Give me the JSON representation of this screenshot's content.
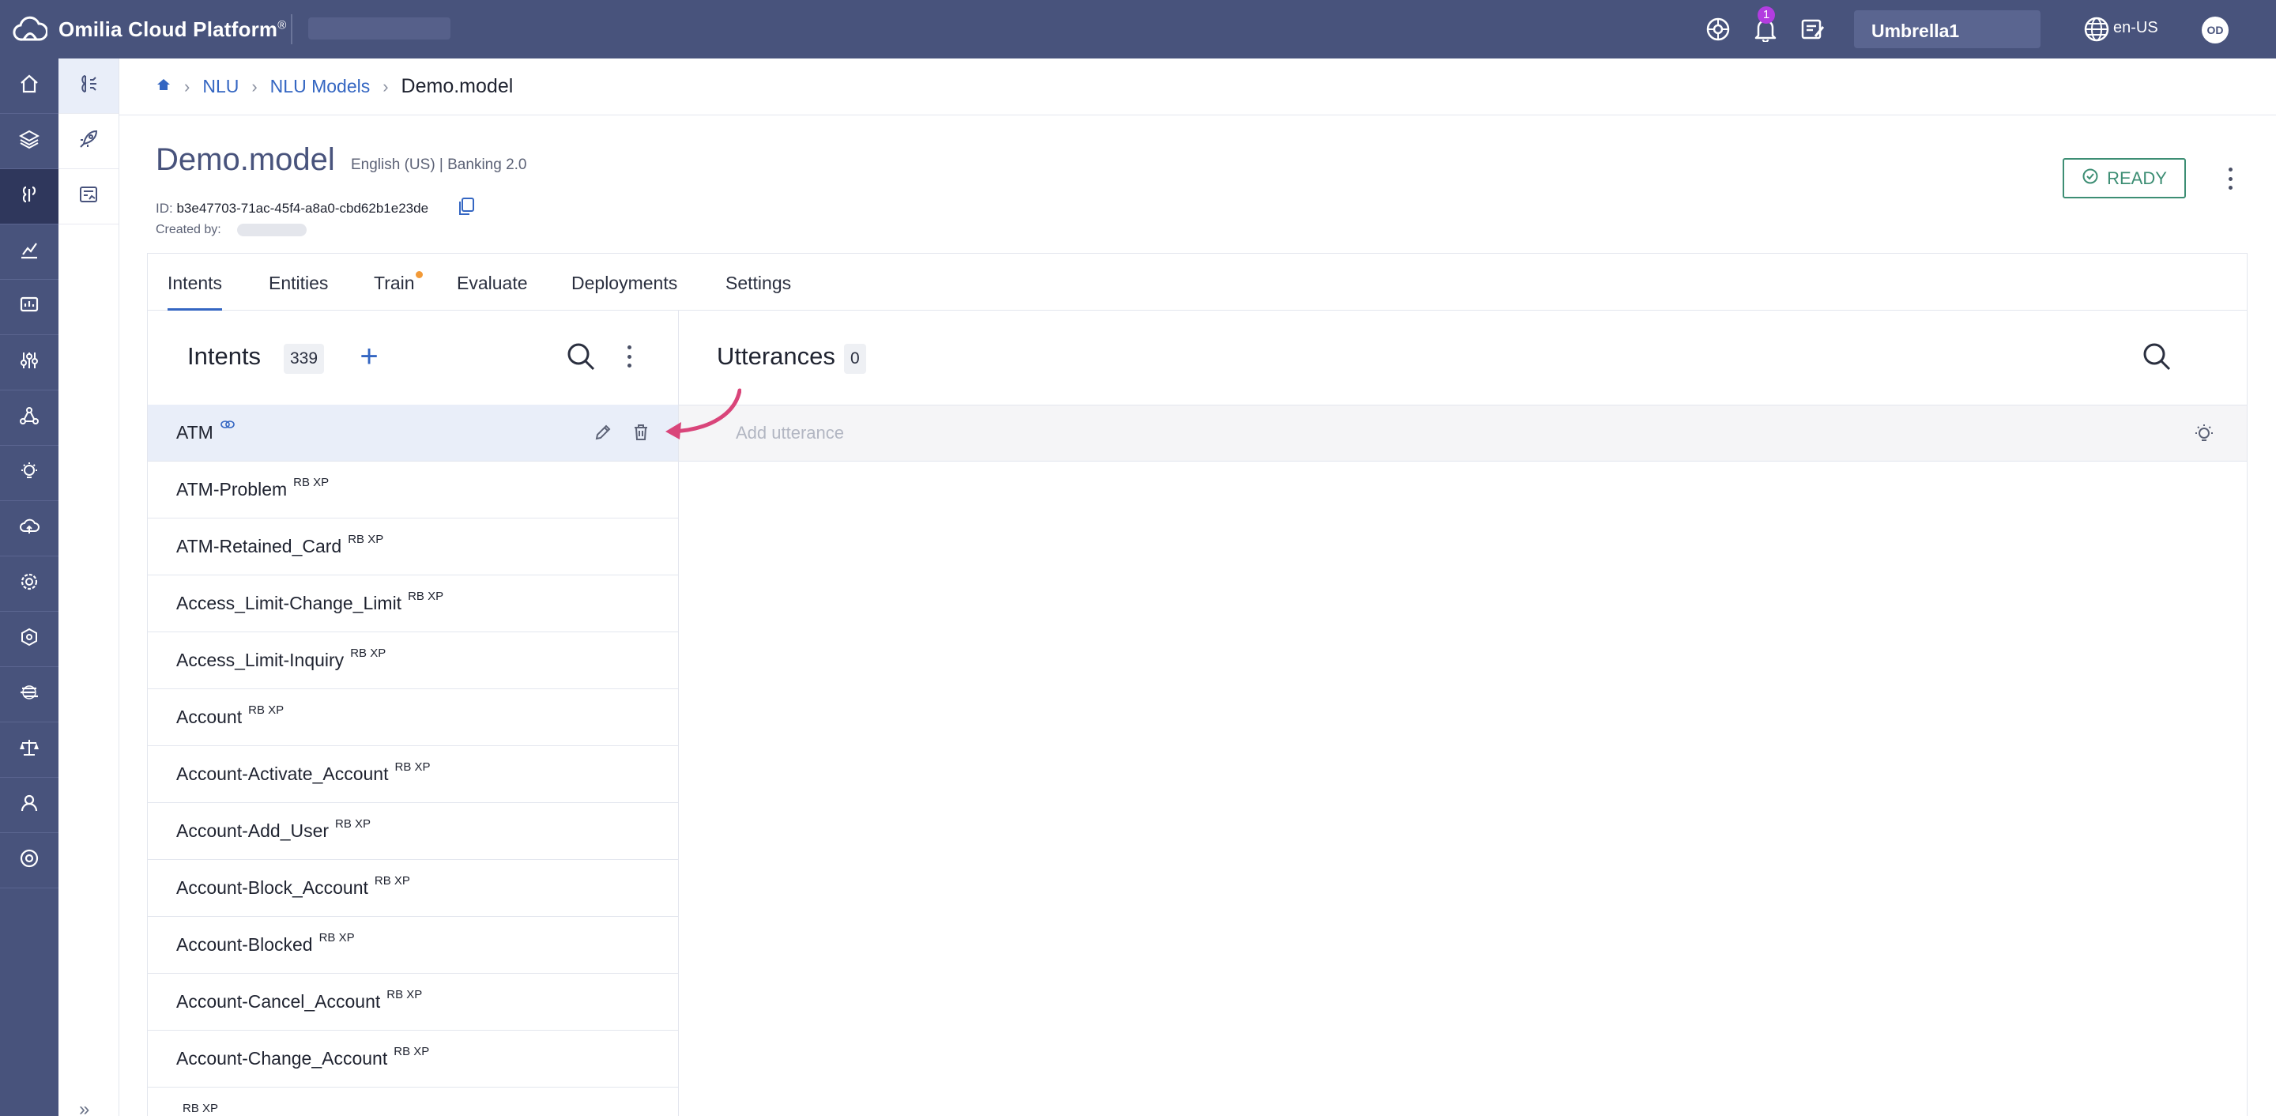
{
  "topbar": {
    "app_name": "Omilia Cloud Platform",
    "app_name_mark": "®",
    "notification_count": "1",
    "tenant": "Umbrella1",
    "language": "en-US",
    "avatar_initials": "OD",
    "icons": [
      "cloud-logo-icon",
      "help-wheel-icon",
      "bell-icon",
      "release-notes-icon",
      "globe-icon"
    ]
  },
  "rail": {
    "icons": [
      "home-icon",
      "layers-icon",
      "nlu-icon",
      "analytics-icon",
      "monitor-icon",
      "sliders-icon",
      "network-icon",
      "insights-bulb-icon",
      "cloud-upload-icon",
      "settings-gear-icon",
      "package-icon",
      "orchestrator-icon",
      "balance-icon",
      "user-icon",
      "support-icon"
    ]
  },
  "subrail": {
    "icons": [
      "models-icon",
      "rocket-icon",
      "reports-icon"
    ],
    "expand_label": "»"
  },
  "breadcrumb": {
    "items": [
      "NLU",
      "NLU Models"
    ],
    "current": "Demo.model",
    "separator": "›"
  },
  "model": {
    "title": "Demo.model",
    "subtitle": "English (US) | Banking 2.0",
    "id_label": "ID:",
    "id_value": "b3e47703-71ac-45f4-a8a0-cbd62b1e23de",
    "created_label": "Created by:",
    "status": "READY"
  },
  "tabs": [
    "Intents",
    "Entities",
    "Train",
    "Evaluate",
    "Deployments",
    "Settings"
  ],
  "intents": {
    "title": "Intents",
    "count": "339",
    "add_label": "+",
    "items": [
      {
        "name": "ATM",
        "tag": ""
      },
      {
        "name": "ATM-Problem",
        "tag": "RB XP"
      },
      {
        "name": "ATM-Retained_Card",
        "tag": "RB XP"
      },
      {
        "name": "Access_Limit-Change_Limit",
        "tag": "RB XP"
      },
      {
        "name": "Access_Limit-Inquiry",
        "tag": "RB XP"
      },
      {
        "name": "Account",
        "tag": "RB XP"
      },
      {
        "name": "Account-Activate_Account",
        "tag": "RB XP"
      },
      {
        "name": "Account-Add_User",
        "tag": "RB XP"
      },
      {
        "name": "Account-Block_Account",
        "tag": "RB XP"
      },
      {
        "name": "Account-Blocked",
        "tag": "RB XP"
      },
      {
        "name": "Account-Cancel_Account",
        "tag": "RB XP"
      },
      {
        "name": "Account-Change_Account",
        "tag": "RB XP"
      },
      {
        "name": "",
        "tag": "RB XP"
      }
    ]
  },
  "utterances": {
    "title": "Utterances",
    "count": "0",
    "placeholder": "Add utterance"
  },
  "colors": {
    "nav": "#48537c",
    "accent": "#3466c2",
    "ready": "#3d8e74",
    "badge": "#b23de0",
    "arrow": "#d9457a",
    "train_dot": "#f29a38"
  }
}
